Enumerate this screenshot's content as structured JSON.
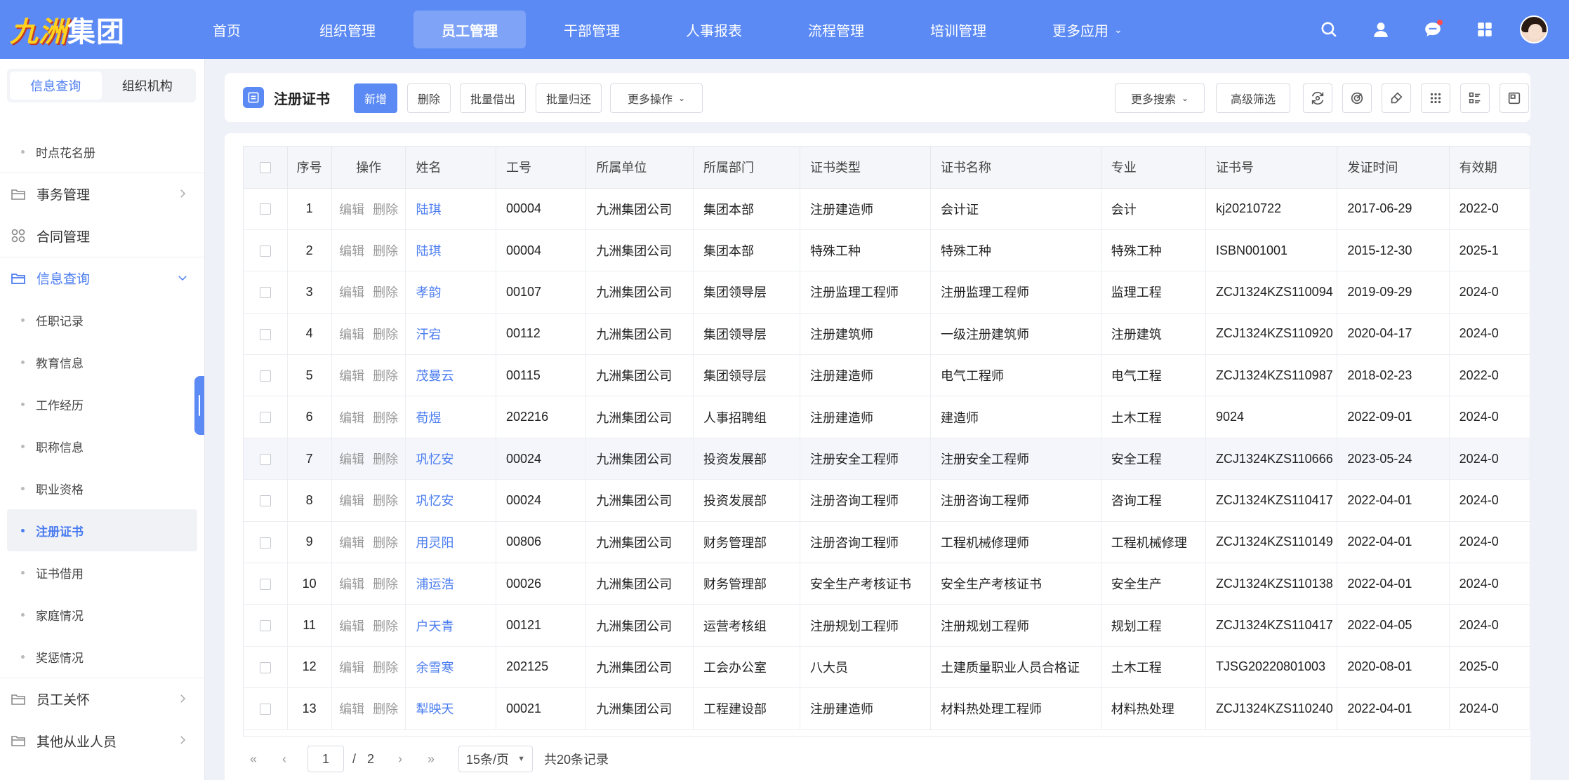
{
  "logo": {
    "part1": "九洲",
    "part2": "集团"
  },
  "nav": [
    {
      "label": "首页",
      "active": false
    },
    {
      "label": "组织管理",
      "active": false
    },
    {
      "label": "员工管理",
      "active": true
    },
    {
      "label": "干部管理",
      "active": false
    },
    {
      "label": "人事报表",
      "active": false
    },
    {
      "label": "流程管理",
      "active": false
    },
    {
      "label": "培训管理",
      "active": false
    },
    {
      "label": "更多应用",
      "active": false
    }
  ],
  "top_icons": [
    "search-icon",
    "user-icon",
    "message-icon",
    "apps-icon"
  ],
  "sidebar": {
    "tabs": [
      {
        "label": "信息查询",
        "active": true
      },
      {
        "label": "组织机构",
        "active": false
      }
    ],
    "first_sub": "时点花名册",
    "groups_before": [
      {
        "label": "事务管理",
        "icon": "folder-icon"
      },
      {
        "label": "合同管理",
        "icon": "grid-icon"
      }
    ],
    "open_group": {
      "label": "信息查询"
    },
    "sub_items": [
      {
        "label": "任职记录",
        "active": false
      },
      {
        "label": "教育信息",
        "active": false
      },
      {
        "label": "工作经历",
        "active": false
      },
      {
        "label": "职称信息",
        "active": false
      },
      {
        "label": "职业资格",
        "active": false
      },
      {
        "label": "注册证书",
        "active": true
      },
      {
        "label": "证书借用",
        "active": false
      },
      {
        "label": "家庭情况",
        "active": false
      },
      {
        "label": "奖惩情况",
        "active": false
      }
    ],
    "groups_after": [
      {
        "label": "员工关怀"
      },
      {
        "label": "其他从业人员"
      }
    ]
  },
  "toolbar": {
    "title": "注册证书",
    "add": "新增",
    "delete": "删除",
    "batch_borrow": "批量借出",
    "batch_return": "批量归还",
    "more_ops": "更多操作",
    "more_search": "更多搜索",
    "advanced_filter": "高级筛选"
  },
  "table": {
    "headers": [
      "序号",
      "操作",
      "姓名",
      "工号",
      "所属单位",
      "所属部门",
      "证书类型",
      "证书名称",
      "专业",
      "证书号",
      "发证时间",
      "有效期"
    ],
    "op_edit": "编辑",
    "op_delete": "删除",
    "rows": [
      [
        "1",
        "陆琪",
        "00004",
        "九洲集团公司",
        "集团本部",
        "注册建造师",
        "会计证",
        "会计",
        "kj20210722",
        "2017-06-29",
        "2022-0"
      ],
      [
        "2",
        "陆琪",
        "00004",
        "九洲集团公司",
        "集团本部",
        "特殊工种",
        "特殊工种",
        "特殊工种",
        "ISBN001001",
        "2015-12-30",
        "2025-1"
      ],
      [
        "3",
        "孝韵",
        "00107",
        "九洲集团公司",
        "集团领导层",
        "注册监理工程师",
        "注册监理工程师",
        "监理工程",
        "ZCJ1324KZS110094",
        "2019-09-29",
        "2024-0"
      ],
      [
        "4",
        "汗宕",
        "00112",
        "九洲集团公司",
        "集团领导层",
        "注册建筑师",
        "一级注册建筑师",
        "注册建筑",
        "ZCJ1324KZS110920",
        "2020-04-17",
        "2024-0"
      ],
      [
        "5",
        "茂曼云",
        "00115",
        "九洲集团公司",
        "集团领导层",
        "注册建造师",
        "电气工程师",
        "电气工程",
        "ZCJ1324KZS110987",
        "2018-02-23",
        "2022-0"
      ],
      [
        "6",
        "荀煜",
        "202216",
        "九洲集团公司",
        "人事招聘组",
        "注册建造师",
        "建造师",
        "土木工程",
        "9024",
        "2022-09-01",
        "2024-0"
      ],
      [
        "7",
        "巩忆安",
        "00024",
        "九洲集团公司",
        "投资发展部",
        "注册安全工程师",
        "注册安全工程师",
        "安全工程",
        "ZCJ1324KZS110666",
        "2023-05-24",
        "2024-0"
      ],
      [
        "8",
        "巩忆安",
        "00024",
        "九洲集团公司",
        "投资发展部",
        "注册咨询工程师",
        "注册咨询工程师",
        "咨询工程",
        "ZCJ1324KZS110417",
        "2022-04-01",
        "2024-0"
      ],
      [
        "9",
        "用灵阳",
        "00806",
        "九洲集团公司",
        "财务管理部",
        "注册咨询工程师",
        "工程机械修理师",
        "工程机械修理",
        "ZCJ1324KZS110149",
        "2022-04-01",
        "2024-0"
      ],
      [
        "10",
        "浦运浩",
        "00026",
        "九洲集团公司",
        "财务管理部",
        "安全生产考核证书",
        "安全生产考核证书",
        "安全生产",
        "ZCJ1324KZS110138",
        "2022-04-01",
        "2024-0"
      ],
      [
        "11",
        "户天青",
        "00121",
        "九洲集团公司",
        "运营考核组",
        "注册规划工程师",
        "注册规划工程师",
        "规划工程",
        "ZCJ1324KZS110417",
        "2022-04-05",
        "2024-0"
      ],
      [
        "12",
        "余雪寒",
        "202125",
        "九洲集团公司",
        "工会办公室",
        "八大员",
        "土建质量职业人员合格证",
        "土木工程",
        "TJSG20220801003",
        "2020-08-01",
        "2025-0"
      ],
      [
        "13",
        "犁映天",
        "00021",
        "九洲集团公司",
        "工程建设部",
        "注册建造师",
        "材料热处理工程师",
        "材料热处理",
        "ZCJ1324KZS110240",
        "2022-04-01",
        "2024-0"
      ]
    ],
    "highlight_row": 6
  },
  "pager": {
    "current": "1",
    "separator": "/",
    "total_pages": "2",
    "page_size": "15条/页",
    "total": "共20条记录"
  },
  "colors": {
    "primary": "#5b8af5",
    "link": "#4a7cf0",
    "logo_yellow": "#ffd21f"
  }
}
